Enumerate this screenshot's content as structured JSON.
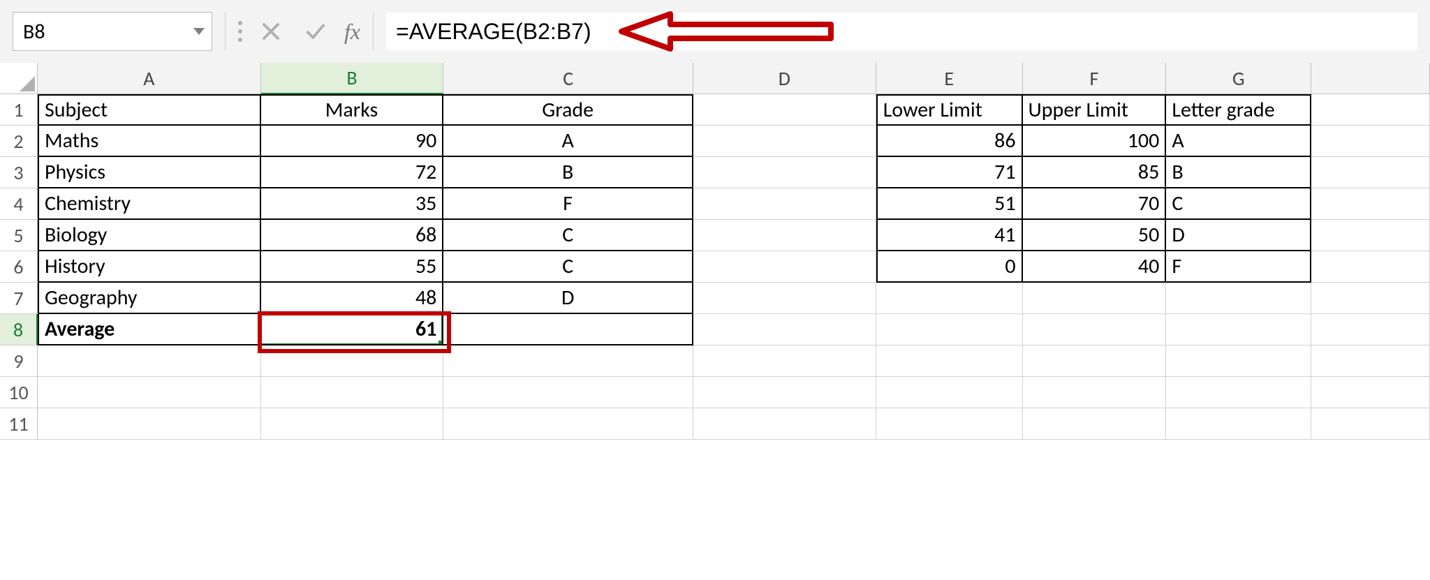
{
  "formula_bar": {
    "name_box": "B8",
    "fx_label": "fx",
    "formula": "=AVERAGE(B2:B7)"
  },
  "columns": [
    "A",
    "B",
    "C",
    "D",
    "E",
    "F",
    "G"
  ],
  "row_numbers": [
    "1",
    "2",
    "3",
    "4",
    "5",
    "6",
    "7",
    "8",
    "9",
    "10",
    "11"
  ],
  "subjects": {
    "headers": {
      "subject": "Subject",
      "marks": "Marks",
      "grade": "Grade"
    },
    "rows": [
      {
        "subject": "Maths",
        "marks": "90",
        "grade": "A"
      },
      {
        "subject": "Physics",
        "marks": "72",
        "grade": "B"
      },
      {
        "subject": "Chemistry",
        "marks": "35",
        "grade": "F"
      },
      {
        "subject": "Biology",
        "marks": "68",
        "grade": "C"
      },
      {
        "subject": "History",
        "marks": "55",
        "grade": "C"
      },
      {
        "subject": "Geography",
        "marks": "48",
        "grade": "D"
      }
    ],
    "average_label": "Average",
    "average_value": "61"
  },
  "grade_scale": {
    "headers": {
      "lower": "Lower Limit",
      "upper": "Upper Limit",
      "letter": "Letter grade"
    },
    "rows": [
      {
        "lower": "86",
        "upper": "100",
        "letter": "A"
      },
      {
        "lower": "71",
        "upper": "85",
        "letter": "B"
      },
      {
        "lower": "51",
        "upper": "70",
        "letter": "C"
      },
      {
        "lower": "41",
        "upper": "50",
        "letter": "D"
      },
      {
        "lower": "0",
        "upper": "40",
        "letter": "F"
      }
    ]
  },
  "selected_cell": "B8",
  "annotation": {
    "arrow_color": "#c00000",
    "highlight_box": "B8"
  }
}
